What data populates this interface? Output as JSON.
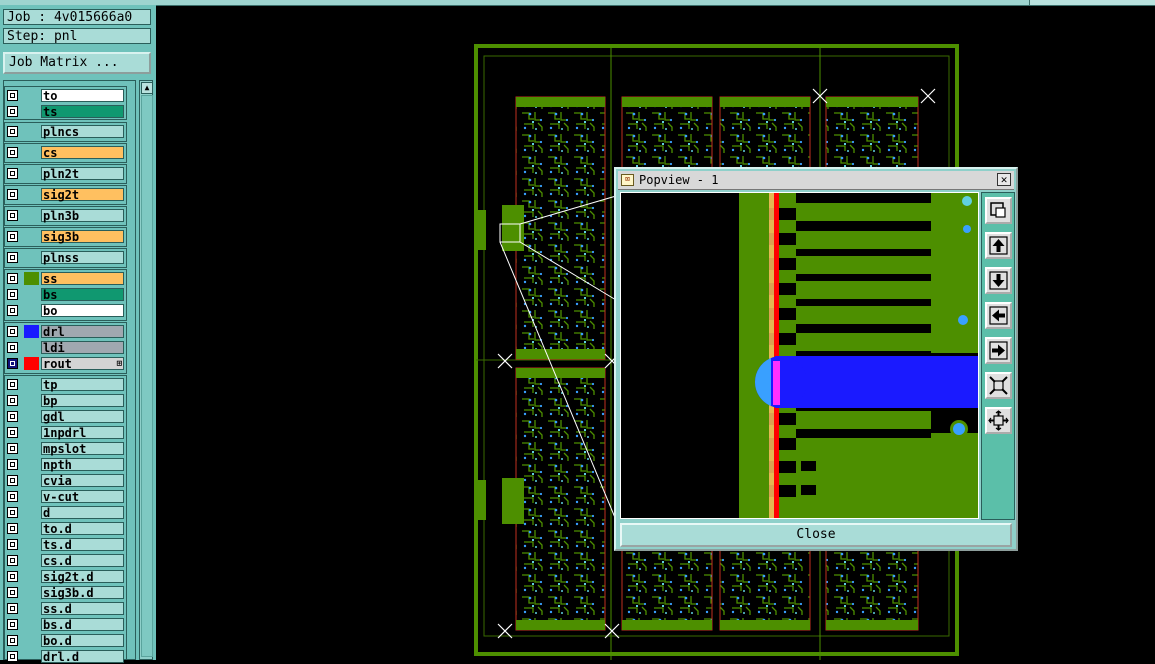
{
  "job": {
    "label": "Job : 4v015666a0",
    "step": "Step: pnl",
    "matrix_button": "Job Matrix ..."
  },
  "popview": {
    "title": "Popview - 1",
    "close_label": "Close",
    "close_x": "✕"
  },
  "colors": {
    "panel": "#6fc2bb",
    "copper": "#4d8f00",
    "drill": "#1a1aff",
    "rout": "#ff0000",
    "orange": "#ffc060",
    "teal": "#109870"
  },
  "layers": [
    {
      "name": "to",
      "label_bg": "#ffffff",
      "swatch": ""
    },
    {
      "name": "ts",
      "label_bg": "#109870",
      "swatch": ""
    },
    {
      "name": "plncs",
      "label_bg": "#a9dcd7",
      "swatch": ""
    },
    {
      "name": "cs",
      "label_bg": "#ffc060",
      "swatch": ""
    },
    {
      "name": "pln2t",
      "label_bg": "#a9dcd7",
      "swatch": ""
    },
    {
      "name": "sig2t",
      "label_bg": "#ffc060",
      "swatch": ""
    },
    {
      "name": "pln3b",
      "label_bg": "#a9dcd7",
      "swatch": ""
    },
    {
      "name": "sig3b",
      "label_bg": "#ffc060",
      "swatch": ""
    },
    {
      "name": "plnss",
      "label_bg": "#a9dcd7",
      "swatch": ""
    },
    {
      "name": "ss",
      "label_bg": "#ffc060",
      "swatch": "#4d8f00"
    },
    {
      "name": "bs",
      "label_bg": "#109870",
      "swatch": ""
    },
    {
      "name": "bo",
      "label_bg": "#ffffff",
      "swatch": ""
    },
    {
      "name": "drl",
      "label_bg": "#a0a8b0",
      "swatch": "#1a1aff"
    },
    {
      "name": "ldi",
      "label_bg": "#a0a8b0",
      "swatch": ""
    },
    {
      "name": "rout",
      "label_bg": "#d4d4d4",
      "swatch": "#ff0000",
      "selected": true,
      "marker": "⊞"
    },
    {
      "name": "tp",
      "label_bg": "#a9dcd7",
      "swatch": ""
    },
    {
      "name": "bp",
      "label_bg": "#a9dcd7",
      "swatch": ""
    },
    {
      "name": "gdl",
      "label_bg": "#a9dcd7",
      "swatch": ""
    },
    {
      "name": "1npdrl",
      "label_bg": "#a9dcd7",
      "swatch": ""
    },
    {
      "name": "mpslot",
      "label_bg": "#a9dcd7",
      "swatch": ""
    },
    {
      "name": "npth",
      "label_bg": "#a9dcd7",
      "swatch": ""
    },
    {
      "name": "cvia",
      "label_bg": "#a9dcd7",
      "swatch": ""
    },
    {
      "name": "v-cut",
      "label_bg": "#a9dcd7",
      "swatch": ""
    },
    {
      "name": "d",
      "label_bg": "#a9dcd7",
      "swatch": ""
    },
    {
      "name": "to.d",
      "label_bg": "#a9dcd7",
      "swatch": ""
    },
    {
      "name": "ts.d",
      "label_bg": "#a9dcd7",
      "swatch": ""
    },
    {
      "name": "cs.d",
      "label_bg": "#a9dcd7",
      "swatch": ""
    },
    {
      "name": "sig2t.d",
      "label_bg": "#a9dcd7",
      "swatch": ""
    },
    {
      "name": "sig3b.d",
      "label_bg": "#a9dcd7",
      "swatch": ""
    },
    {
      "name": "ss.d",
      "label_bg": "#a9dcd7",
      "swatch": ""
    },
    {
      "name": "bs.d",
      "label_bg": "#a9dcd7",
      "swatch": ""
    },
    {
      "name": "bo.d",
      "label_bg": "#a9dcd7",
      "swatch": ""
    },
    {
      "name": "drl.d",
      "label_bg": "#a9dcd7",
      "swatch": ""
    }
  ],
  "tools": [
    "zoom-window-icon",
    "pan-up-icon",
    "pan-down-icon",
    "pan-left-icon",
    "pan-right-icon",
    "zoom-out-icon",
    "zoom-in-icon"
  ]
}
